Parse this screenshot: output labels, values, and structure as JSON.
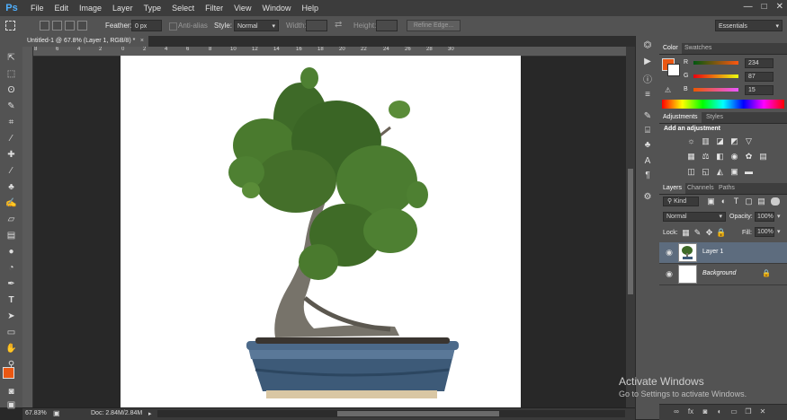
{
  "app": {
    "logo": "Ps"
  },
  "menu": [
    "File",
    "Edit",
    "Image",
    "Layer",
    "Type",
    "Select",
    "Filter",
    "View",
    "Window",
    "Help"
  ],
  "window_controls": [
    "—",
    "□",
    "✕"
  ],
  "options": {
    "feather_label": "Feather:",
    "feather_value": "0 px",
    "antialias_label": "Anti-alias",
    "style_label": "Style:",
    "style_value": "Normal",
    "width_label": "Width:",
    "height_label": "Height:",
    "refine_edge_label": "Refine Edge...",
    "workspace_value": "Essentials"
  },
  "document": {
    "tab_title": "Untitled-1 @ 67.8% (Layer 1, RGB/8) *",
    "close_glyph": "×"
  },
  "ruler_numbers": [
    "8",
    "6",
    "4",
    "2",
    "0",
    "2",
    "4",
    "6",
    "8",
    "10",
    "12",
    "14",
    "16",
    "18",
    "20",
    "22",
    "24",
    "26",
    "28",
    "30"
  ],
  "status": {
    "zoom": "67.83%",
    "doc_info": "Doc: 2.84M/2.84M"
  },
  "color_panel": {
    "tabs": [
      "Color",
      "Swatches"
    ],
    "foreground_color": "#ea5712",
    "background_color": "#ffffff",
    "channels": [
      {
        "label": "R",
        "value": "234"
      },
      {
        "label": "G",
        "value": "87"
      },
      {
        "label": "B",
        "value": "15"
      }
    ]
  },
  "adjustments_panel": {
    "tabs": [
      "Adjustments",
      "Styles"
    ],
    "heading": "Add an adjustment"
  },
  "layers_panel": {
    "tabs": [
      "Layers",
      "Channels",
      "Paths"
    ],
    "kind_label": "Kind",
    "blend_mode": "Normal",
    "opacity_label": "Opacity:",
    "opacity_value": "100%",
    "lock_label": "Lock:",
    "fill_label": "Fill:",
    "fill_value": "100%",
    "layers": [
      {
        "name": "Layer 1",
        "selected": true
      },
      {
        "name": "Background",
        "selected": false
      }
    ],
    "footer_icons": [
      "link-icon",
      "fx-icon",
      "mask-icon",
      "adjustment-layer-icon",
      "folder-icon",
      "new-layer-icon",
      "trash-icon"
    ]
  },
  "watermark": {
    "title": "Activate Windows",
    "subtitle": "Go to Settings to activate Windows."
  }
}
